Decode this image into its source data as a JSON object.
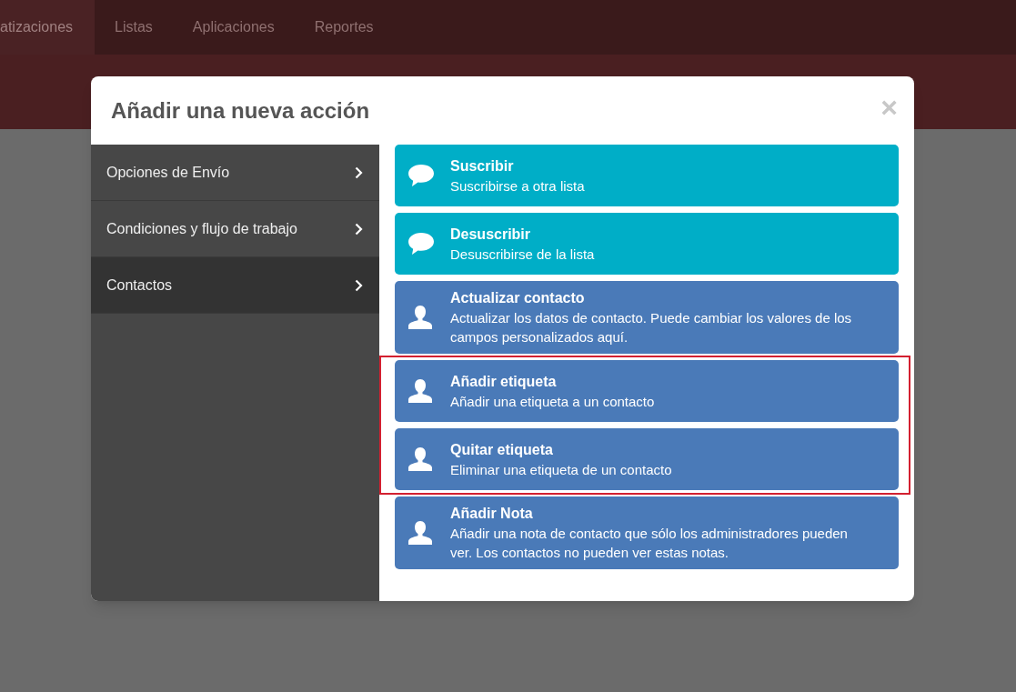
{
  "nav": {
    "items": [
      {
        "label": "atizaciones",
        "selected": true
      },
      {
        "label": "Listas",
        "selected": false
      },
      {
        "label": "Aplicaciones",
        "selected": false
      },
      {
        "label": "Reportes",
        "selected": false
      }
    ]
  },
  "modal": {
    "title": "Añadir una nueva acción",
    "close": "×",
    "sidebar": {
      "items": [
        {
          "label": "Opciones de Envío",
          "selected": false
        },
        {
          "label": "Condiciones y flujo de trabajo",
          "selected": false
        },
        {
          "label": "Contactos",
          "selected": true
        }
      ]
    },
    "actions": [
      {
        "kind": "list",
        "title": "Suscribir",
        "description": "Suscribirse a otra lista",
        "highlighted": false
      },
      {
        "kind": "list",
        "title": "Desuscribir",
        "description": "Desuscribirse de la lista",
        "highlighted": false
      },
      {
        "kind": "contact",
        "title": "Actualizar contacto",
        "description": "Actualizar los datos de contacto. Puede cambiar los valores de los campos personalizados aquí.",
        "highlighted": false
      },
      {
        "kind": "contact",
        "title": "Añadir etiqueta",
        "description": "Añadir una etiqueta a un contacto",
        "highlighted": true
      },
      {
        "kind": "contact",
        "title": "Quitar etiqueta",
        "description": "Eliminar una etiqueta de un contacto",
        "highlighted": true
      },
      {
        "kind": "contact",
        "title": "Añadir Nota",
        "description": "Añadir una nota de contacto que sólo los administradores pueden ver. Los contactos no pueden ver estas notas.",
        "highlighted": false
      }
    ]
  }
}
